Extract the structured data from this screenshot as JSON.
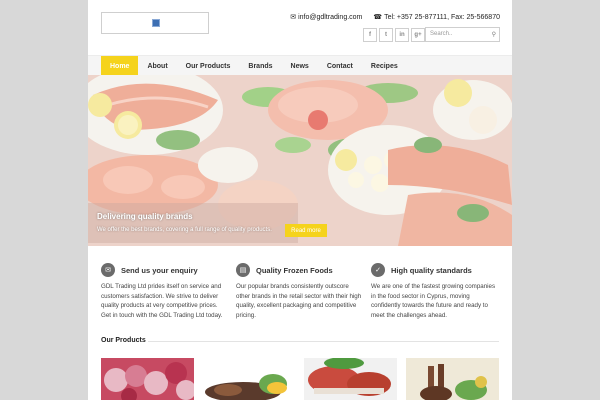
{
  "header": {
    "email": "info@gdltrading.com",
    "phone": "Tel: +357 25-877111, Fax: 25-566870",
    "social": [
      "f",
      "t",
      "in",
      "g+"
    ],
    "search_placeholder": "Search.."
  },
  "nav": {
    "items": [
      "Home",
      "About",
      "Our Products",
      "Brands",
      "News",
      "Contact",
      "Recipes"
    ]
  },
  "hero": {
    "title": "Delivering quality brands",
    "subtitle": "We offer the best brands, covering a full range of quality products.",
    "button": "Read more"
  },
  "features": [
    {
      "title": "Send us your enquiry",
      "icon": "envelope-icon",
      "text": "GDL Trading Ltd prides itself on service and customers satisfaction. We strive to deliver quality products at very competitive prices. Get in touch with the GDL Trading Ltd today."
    },
    {
      "title": "Quality Frozen Foods",
      "icon": "list-icon",
      "text": "Our popular brands consistently outscore other brands in the retail sector with their high quality, excellent packaging and competitive pricing."
    },
    {
      "title": "High quality standards",
      "icon": "check-icon",
      "text": "We are one of the fastest growing companies in the food sector in Cyprus, moving confidently towards the future and ready to meet the challenges ahead."
    }
  ],
  "products": {
    "title": "Our Products"
  },
  "colors": {
    "accent": "#f5d31c",
    "side_band": "#d8d8d8"
  }
}
